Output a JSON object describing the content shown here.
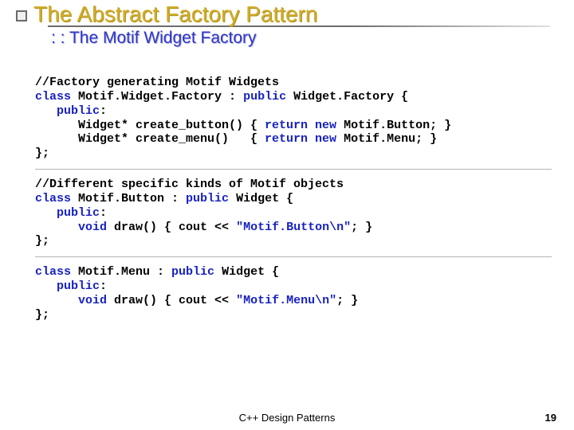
{
  "header": {
    "title": "The Abstract Factory Pattern",
    "subtitle": ": : The Motif Widget Factory"
  },
  "code": {
    "block1": {
      "l1a": "//Factory generating Motif Widgets",
      "l2a": "class",
      "l2b": " Motif.Widget.Factory : ",
      "l2c": "public",
      "l2d": " Widget.Factory {",
      "l3a": "   ",
      "l3b": "public",
      "l3c": ":",
      "l4a": "      Widget* create_button() { ",
      "l4b": "return new",
      "l4c": " Motif.Button; }",
      "l5a": "      Widget* create_menu()   { ",
      "l5b": "return new",
      "l5c": " Motif.Menu; }",
      "l6a": "};"
    },
    "block2": {
      "l1a": "//Different specific kinds of Motif objects",
      "l2a": "class",
      "l2b": " Motif.Button : ",
      "l2c": "public",
      "l2d": " Widget {",
      "l3a": "   ",
      "l3b": "public",
      "l3c": ":",
      "l4a": "      ",
      "l4b": "void",
      "l4c": " draw() { cout << ",
      "l4d": "\"Motif.Button\\n\"",
      "l4e": "; }",
      "l5a": "};"
    },
    "block3": {
      "l1a": "class",
      "l1b": " Motif.Menu : ",
      "l1c": "public",
      "l1d": " Widget {",
      "l2a": "   ",
      "l2b": "public",
      "l2c": ":",
      "l3a": "      ",
      "l3b": "void",
      "l3c": " draw() { cout << ",
      "l3d": "\"Motif.Menu\\n\"",
      "l3e": "; }",
      "l4a": "};"
    }
  },
  "footer": {
    "center": "C++ Design Patterns",
    "page": "19"
  }
}
